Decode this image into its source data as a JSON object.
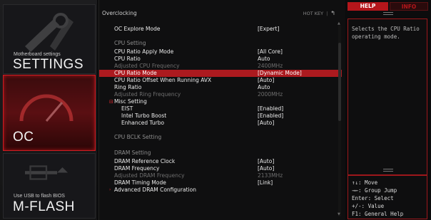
{
  "sidebar": {
    "settings": {
      "subtitle": "Motherboard settings",
      "title": "SETTINGS"
    },
    "oc": {
      "title": "OC"
    },
    "mflash": {
      "subtitle": "Use USB to flash BIOS",
      "title": "M-FLASH"
    }
  },
  "main": {
    "title": "Overclocking",
    "hotkey_label": "HOT KEY",
    "hotkey_sep": "|",
    "back_symbol": "↰",
    "rows": [
      {
        "label": "OC Explore Mode",
        "value": "[Expert]",
        "kind": "item"
      },
      {
        "label": "",
        "value": "",
        "kind": "spacer"
      },
      {
        "label": "CPU Setting",
        "value": "",
        "kind": "section"
      },
      {
        "label": "CPU Ratio Apply Mode",
        "value": "[All Core]",
        "kind": "item"
      },
      {
        "label": "CPU Ratio",
        "value": "Auto",
        "kind": "item"
      },
      {
        "label": "Adjusted CPU Frequency",
        "value": "2400MHz",
        "kind": "dim"
      },
      {
        "label": "CPU Ratio Mode",
        "value": "[Dynamic Mode]",
        "kind": "selected"
      },
      {
        "label": "CPU Ratio Offset When Running AVX",
        "value": "[Auto]",
        "kind": "item"
      },
      {
        "label": "Ring Ratio",
        "value": "Auto",
        "kind": "item"
      },
      {
        "label": "Adjusted Ring Frequency",
        "value": "2000MHz",
        "kind": "dim"
      },
      {
        "label": "Misc Setting",
        "value": "",
        "kind": "group",
        "marker": "⊟"
      },
      {
        "label": "EIST",
        "value": "[Enabled]",
        "kind": "sub"
      },
      {
        "label": "Intel Turbo Boost",
        "value": "[Enabled]",
        "kind": "sub"
      },
      {
        "label": "Enhanced Turbo",
        "value": "[Auto]",
        "kind": "sub"
      },
      {
        "label": "",
        "value": "",
        "kind": "spacer"
      },
      {
        "label": "CPU BCLK Setting",
        "value": "",
        "kind": "section"
      },
      {
        "label": "",
        "value": "",
        "kind": "spacer"
      },
      {
        "label": "DRAM Setting",
        "value": "",
        "kind": "section"
      },
      {
        "label": "DRAM Reference Clock",
        "value": "[Auto]",
        "kind": "item"
      },
      {
        "label": "DRAM Frequency",
        "value": "[Auto]",
        "kind": "item"
      },
      {
        "label": "Adjusted DRAM Frequency",
        "value": "2133MHz",
        "kind": "dim"
      },
      {
        "label": "DRAM Timing Mode",
        "value": "[Link]",
        "kind": "item"
      },
      {
        "label": "Advanced DRAM Configuration",
        "value": "",
        "kind": "submenu",
        "marker": "›"
      }
    ]
  },
  "help_panel": {
    "tab_help": "HELP",
    "tab_info": "INFO",
    "text": "Selects the CPU Ratio operating mode.",
    "keys": [
      "↑↓: Move",
      "→←: Group Jump",
      "Enter: Select",
      "+/-: Value",
      "F1: General Help"
    ]
  },
  "colors": {
    "accent": "#b5161b",
    "selected_row": "#ac1a1f",
    "dim_text": "#6e6e6e"
  }
}
